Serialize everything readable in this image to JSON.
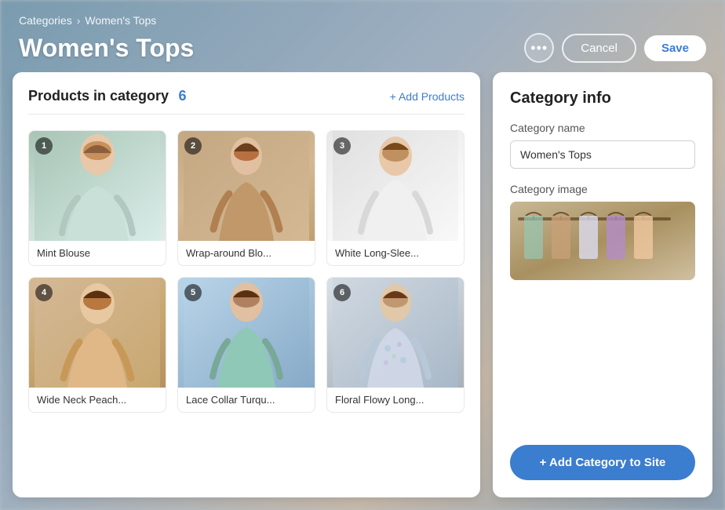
{
  "page": {
    "background_description": "blurred fashion background"
  },
  "breadcrumb": {
    "parent_label": "Categories",
    "separator": "›",
    "current_label": "Women's Tops"
  },
  "header": {
    "title": "Women's Tops",
    "more_icon": "•••",
    "cancel_label": "Cancel",
    "save_label": "Save"
  },
  "products_panel": {
    "title": "Products in category",
    "count": 6,
    "add_label": "+ Add Products",
    "products": [
      {
        "id": 1,
        "number": "1",
        "name": "Mint Blouse",
        "img_class": "product-img-1"
      },
      {
        "id": 2,
        "number": "2",
        "name": "Wrap-around Blo...",
        "img_class": "product-img-2"
      },
      {
        "id": 3,
        "number": "3",
        "name": "White Long-Slee...",
        "img_class": "product-img-3"
      },
      {
        "id": 4,
        "number": "4",
        "name": "Wide Neck Peach...",
        "img_class": "product-img-4"
      },
      {
        "id": 5,
        "number": "5",
        "name": "Lace Collar Turqu...",
        "img_class": "product-img-5"
      },
      {
        "id": 6,
        "number": "6",
        "name": "Floral Flowy Long...",
        "img_class": "product-img-6"
      }
    ]
  },
  "category_panel": {
    "title": "Category info",
    "name_label": "Category name",
    "name_value": "Women's Tops",
    "name_placeholder": "Women's Tops",
    "image_label": "Category image",
    "add_to_site_label": "+ Add Category to Site"
  }
}
